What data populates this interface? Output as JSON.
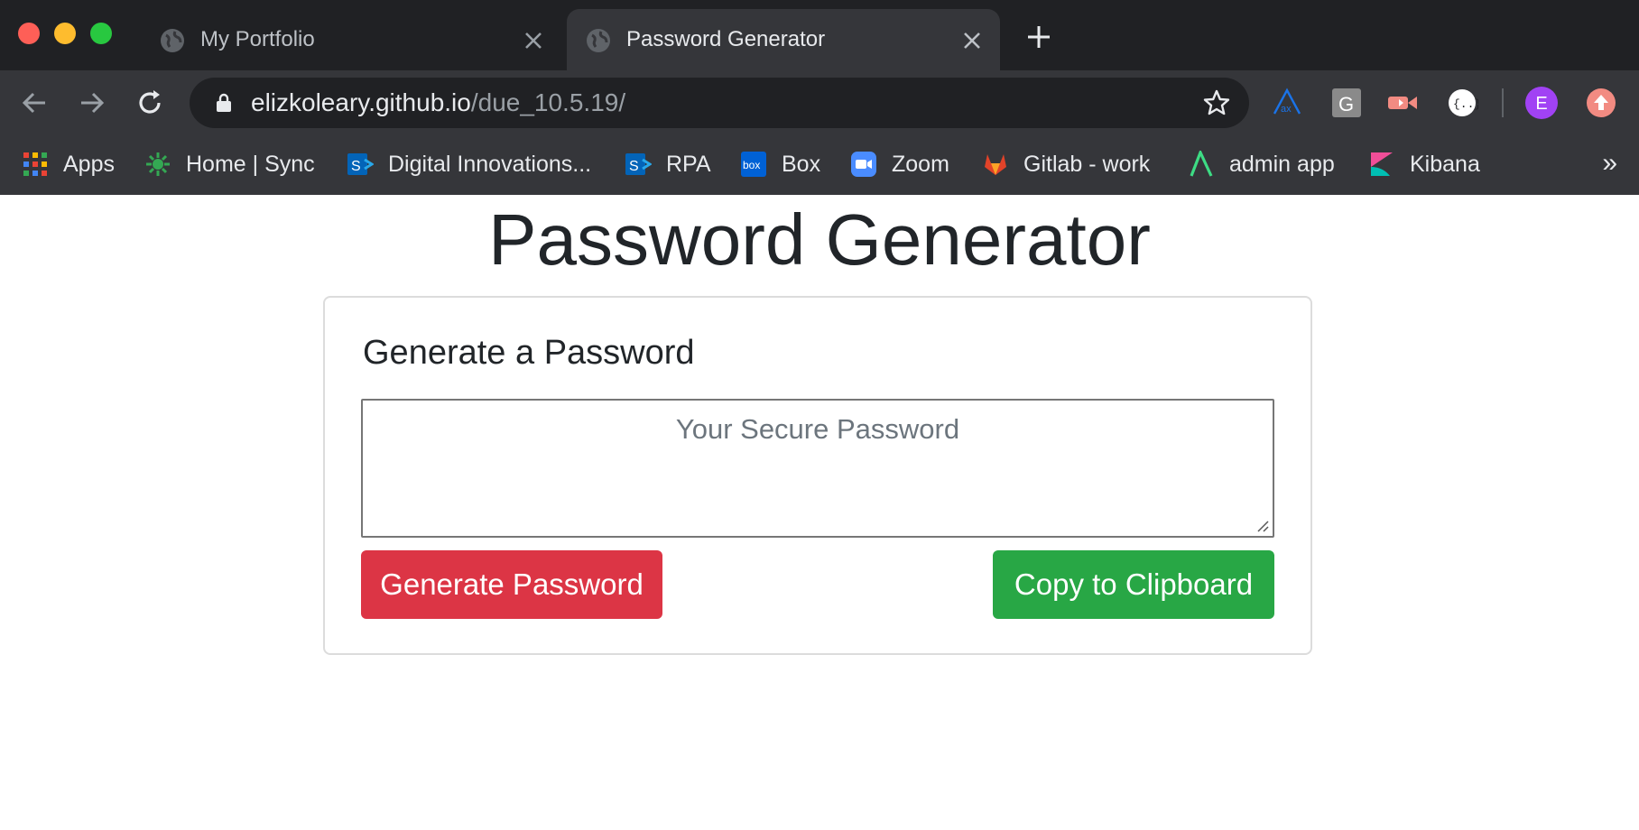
{
  "browser": {
    "tabs": [
      {
        "title": "My Portfolio",
        "active": false
      },
      {
        "title": "Password Generator",
        "active": true
      }
    ],
    "address": {
      "host": "elizkoleary.github.io",
      "path": "/due_10.5.19/"
    },
    "profile_initial": "E",
    "bookmarks": [
      {
        "label": "Apps",
        "icon": "apps-grid-icon"
      },
      {
        "label": "Home | Sync",
        "icon": "sync-icon"
      },
      {
        "label": "Digital Innovations...",
        "icon": "sharepoint-icon"
      },
      {
        "label": "RPA",
        "icon": "sharepoint-icon"
      },
      {
        "label": "Box",
        "icon": "box-icon"
      },
      {
        "label": "Zoom",
        "icon": "zoom-icon"
      },
      {
        "label": "Gitlab - work",
        "icon": "gitlab-icon"
      },
      {
        "label": "admin app",
        "icon": "admin-app-icon"
      },
      {
        "label": "Kibana",
        "icon": "kibana-icon"
      }
    ],
    "bookmarks_overflow": "»",
    "extension_g_label": "G"
  },
  "page": {
    "title": "Password Generator",
    "card_title": "Generate a Password",
    "password_placeholder": "Your Secure Password",
    "generate_label": "Generate Password",
    "copy_label": "Copy to Clipboard"
  },
  "colors": {
    "generate_button": "#dc3545",
    "copy_button": "#28a745",
    "profile_avatar": "#a142f4"
  }
}
